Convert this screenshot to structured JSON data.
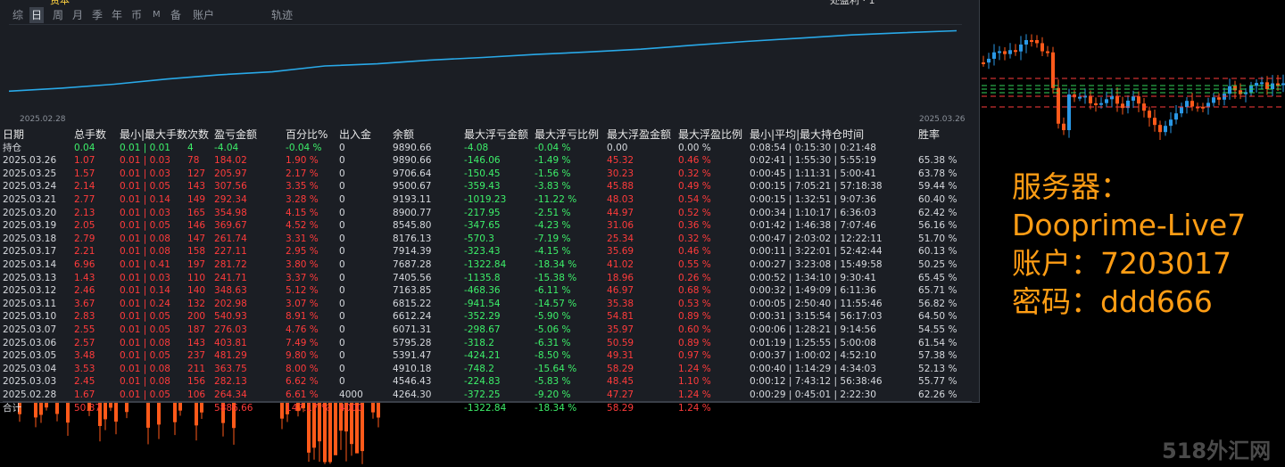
{
  "header": {
    "top_left_partial": "资本",
    "top_right_partial": "处盈利 · 1",
    "tabs": [
      {
        "label": "综",
        "active": false
      },
      {
        "label": "日",
        "active": true
      },
      {
        "label": "周",
        "active": false
      },
      {
        "label": "月",
        "active": false
      },
      {
        "label": "季",
        "active": false
      },
      {
        "label": "年",
        "active": false
      },
      {
        "label": "币",
        "active": false
      },
      {
        "label": "M",
        "active": false
      },
      {
        "label": "备",
        "active": false
      },
      {
        "label": "账户",
        "active": false
      },
      {
        "label": "轨迹",
        "active": false
      }
    ]
  },
  "equity_chart": {
    "start_date": "2025.02.28",
    "end_date": "2025.03.26",
    "line_color": "#29a9e8",
    "points": [
      {
        "date": "2025.02.28",
        "balance": 4264.3
      },
      {
        "date": "2025.03.03",
        "balance": 4546.43
      },
      {
        "date": "2025.03.04",
        "balance": 4910.18
      },
      {
        "date": "2025.03.05",
        "balance": 5391.47
      },
      {
        "date": "2025.03.06",
        "balance": 5795.28
      },
      {
        "date": "2025.03.07",
        "balance": 6071.31
      },
      {
        "date": "2025.03.10",
        "balance": 6612.24
      },
      {
        "date": "2025.03.11",
        "balance": 6815.22
      },
      {
        "date": "2025.03.12",
        "balance": 7163.85
      },
      {
        "date": "2025.03.13",
        "balance": 7405.56
      },
      {
        "date": "2025.03.14",
        "balance": 7687.28
      },
      {
        "date": "2025.03.17",
        "balance": 7914.39
      },
      {
        "date": "2025.03.18",
        "balance": 8176.13
      },
      {
        "date": "2025.03.19",
        "balance": 8545.8
      },
      {
        "date": "2025.03.20",
        "balance": 8900.77
      },
      {
        "date": "2025.03.21",
        "balance": 9193.11
      },
      {
        "date": "2025.03.24",
        "balance": 9500.67
      },
      {
        "date": "2025.03.25",
        "balance": 9706.64
      },
      {
        "date": "2025.03.26",
        "balance": 9890.66
      }
    ]
  },
  "table": {
    "headers": [
      "日期",
      "总手数",
      "最小|最大手数",
      "次数",
      "盈亏金额",
      "百分比%",
      "出入金",
      "余额",
      "最大浮亏金额",
      "最大浮亏比例",
      "最大浮盈金额",
      "最大浮盈比例",
      "最小|平均|最大持仓时间",
      "胜率"
    ],
    "holding": [
      "持仓",
      "0.04",
      "0.01 | 0.01",
      "4",
      "-4.04",
      "-0.04 %",
      "0",
      "9890.66",
      "-4.08",
      "-0.04 %",
      "0.00",
      "0.00 %",
      "0:08:54 | 0:15:30 | 0:21:48",
      ""
    ],
    "rows": [
      [
        "2025.03.26",
        "1.07",
        "0.01 | 0.03",
        "78",
        "184.02",
        "1.90 %",
        "0",
        "9890.66",
        "-146.06",
        "-1.49 %",
        "45.32",
        "0.46 %",
        "0:02:41 | 1:55:30 | 5:55:19",
        "65.38 %"
      ],
      [
        "2025.03.25",
        "1.57",
        "0.01 | 0.03",
        "127",
        "205.97",
        "2.17 %",
        "0",
        "9706.64",
        "-150.45",
        "-1.56 %",
        "30.23",
        "0.32 %",
        "0:00:45 | 1:11:31 | 5:00:41",
        "63.78 %"
      ],
      [
        "2025.03.24",
        "2.14",
        "0.01 | 0.05",
        "143",
        "307.56",
        "3.35 %",
        "0",
        "9500.67",
        "-359.43",
        "-3.83 %",
        "45.88",
        "0.49 %",
        "0:00:15 | 7:05:21 | 57:18:38",
        "59.44 %"
      ],
      [
        "2025.03.21",
        "2.77",
        "0.01 | 0.14",
        "149",
        "292.34",
        "3.28 %",
        "0",
        "9193.11",
        "-1019.23",
        "-11.22 %",
        "48.03",
        "0.54 %",
        "0:00:15 | 1:32:51 | 9:07:36",
        "60.40 %"
      ],
      [
        "2025.03.20",
        "2.13",
        "0.01 | 0.03",
        "165",
        "354.98",
        "4.15 %",
        "0",
        "8900.77",
        "-217.95",
        "-2.51 %",
        "44.97",
        "0.52 %",
        "0:00:34 | 1:10:17 | 6:36:03",
        "62.42 %"
      ],
      [
        "2025.03.19",
        "2.05",
        "0.01 | 0.05",
        "146",
        "369.67",
        "4.52 %",
        "0",
        "8545.80",
        "-347.65",
        "-4.23 %",
        "31.06",
        "0.36 %",
        "0:01:42 | 1:46:38 | 7:07:46",
        "56.16 %"
      ],
      [
        "2025.03.18",
        "2.79",
        "0.01 | 0.08",
        "147",
        "261.74",
        "3.31 %",
        "0",
        "8176.13",
        "-570.3",
        "-7.19 %",
        "25.34",
        "0.32 %",
        "0:00:47 | 2:03:02 | 12:22:11",
        "51.70 %"
      ],
      [
        "2025.03.17",
        "2.21",
        "0.01 | 0.08",
        "158",
        "227.11",
        "2.95 %",
        "0",
        "7914.39",
        "-323.43",
        "-4.15 %",
        "35.69",
        "0.46 %",
        "0:00:11 | 3:22:01 | 52:42:44",
        "60.13 %"
      ],
      [
        "2025.03.14",
        "6.96",
        "0.01 | 0.41",
        "197",
        "281.72",
        "3.80 %",
        "0",
        "7687.28",
        "-1322.84",
        "-18.34 %",
        "41.02",
        "0.55 %",
        "0:00:27 | 3:23:08 | 15:49:58",
        "50.25 %"
      ],
      [
        "2025.03.13",
        "1.43",
        "0.01 | 0.03",
        "110",
        "241.71",
        "3.37 %",
        "0",
        "7405.56",
        "-1135.8",
        "-15.38 %",
        "18.96",
        "0.26 %",
        "0:00:52 | 1:34:10 | 9:30:41",
        "65.45 %"
      ],
      [
        "2025.03.12",
        "2.46",
        "0.01 | 0.14",
        "140",
        "348.63",
        "5.12 %",
        "0",
        "7163.85",
        "-468.36",
        "-6.11 %",
        "46.97",
        "0.68 %",
        "0:00:32 | 1:49:09 | 6:11:36",
        "65.71 %"
      ],
      [
        "2025.03.11",
        "3.67",
        "0.01 | 0.24",
        "132",
        "202.98",
        "3.07 %",
        "0",
        "6815.22",
        "-941.54",
        "-14.57 %",
        "35.38",
        "0.53 %",
        "0:00:05 | 2:50:40 | 11:55:46",
        "56.82 %"
      ],
      [
        "2025.03.10",
        "2.83",
        "0.01 | 0.05",
        "200",
        "540.93",
        "8.91 %",
        "0",
        "6612.24",
        "-352.29",
        "-5.90 %",
        "54.81",
        "0.89 %",
        "0:00:31 | 3:15:54 | 56:17:03",
        "64.50 %"
      ],
      [
        "2025.03.07",
        "2.55",
        "0.01 | 0.05",
        "187",
        "276.03",
        "4.76 %",
        "0",
        "6071.31",
        "-298.67",
        "-5.06 %",
        "35.97",
        "0.60 %",
        "0:00:06 | 1:28:21 | 9:14:56",
        "54.55 %"
      ],
      [
        "2025.03.06",
        "2.57",
        "0.01 | 0.08",
        "143",
        "403.81",
        "7.49 %",
        "0",
        "5795.28",
        "-318.2",
        "-6.31 %",
        "50.59",
        "0.89 %",
        "0:01:19 | 1:25:55 | 5:00:08",
        "61.54 %"
      ],
      [
        "2025.03.05",
        "3.48",
        "0.01 | 0.05",
        "237",
        "481.29",
        "9.80 %",
        "0",
        "5391.47",
        "-424.21",
        "-8.50 %",
        "49.31",
        "0.97 %",
        "0:00:37 | 1:00:02 | 4:52:10",
        "57.38 %"
      ],
      [
        "2025.03.04",
        "3.53",
        "0.01 | 0.08",
        "211",
        "363.75",
        "8.00 %",
        "0",
        "4910.18",
        "-748.2",
        "-15.64 %",
        "58.29",
        "1.24 %",
        "0:00:40 | 1:14:29 | 4:34:03",
        "52.13 %"
      ],
      [
        "2025.03.03",
        "2.45",
        "0.01 | 0.08",
        "156",
        "282.13",
        "6.62 %",
        "0",
        "4546.43",
        "-224.83",
        "-5.83 %",
        "48.45",
        "1.10 %",
        "0:00:12 | 7:43:12 | 56:38:46",
        "55.77 %"
      ],
      [
        "2025.02.28",
        "1.67",
        "0.01 | 0.05",
        "106",
        "264.34",
        "6.61 %",
        "4000",
        "4264.30",
        "-372.25",
        "-9.20 %",
        "47.27",
        "1.24 %",
        "0:00:29 | 0:45:01 | 2:22:30",
        "62.26 %"
      ]
    ],
    "total": [
      "合计",
      "50.37",
      "",
      "",
      "5886.66",
      "147.17 %",
      "4000",
      "",
      "-1322.84",
      "-18.34 %",
      "58.29",
      "1.24 %",
      "",
      ""
    ]
  },
  "info_panel": {
    "server_line": "服务器：",
    "server_value": "Dooprime-Live7",
    "account_line": "账户：7203017",
    "password_line": "密码：ddd666",
    "color": "#ff9d14"
  },
  "watermark": "518外汇网",
  "colors": {
    "bull": "#2a98e6",
    "bear": "#ff5a1a",
    "panel_bg": "#1b1e24",
    "profit_red": "#ff3b3b",
    "loss_green": "#3df06a"
  }
}
